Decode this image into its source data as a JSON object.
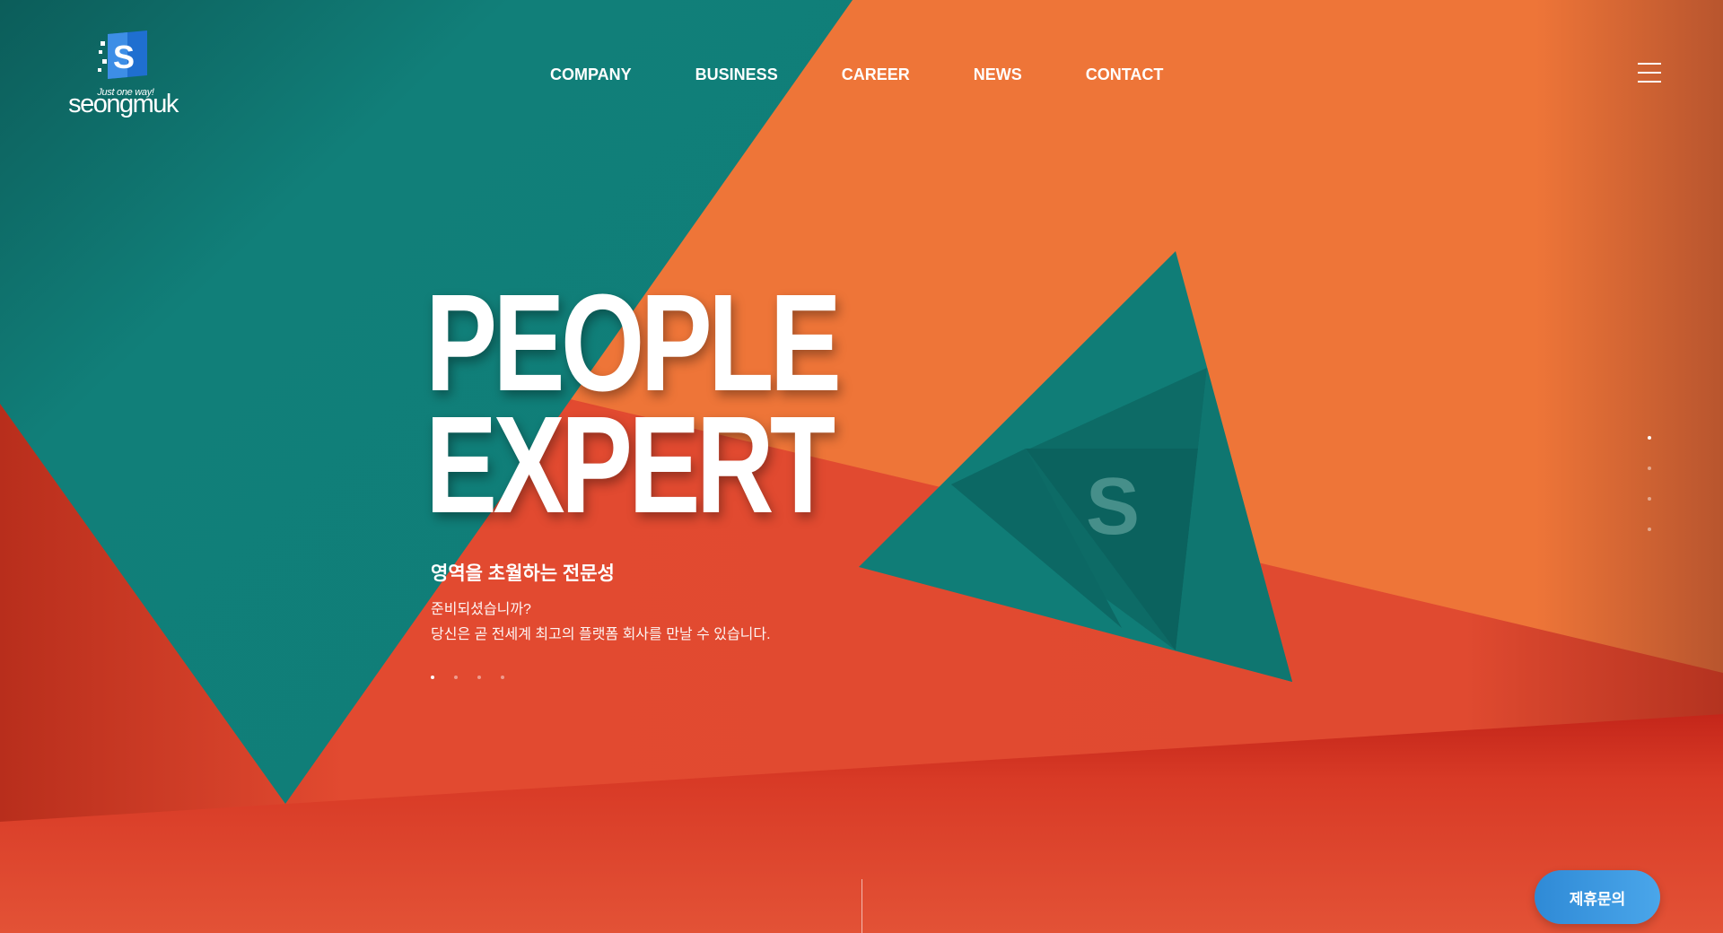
{
  "brand": {
    "logo_tagline": "Just one way!",
    "logo_wordmark": "seongmuk",
    "logo_letter": "S"
  },
  "nav": {
    "items": [
      {
        "label": "COMPANY"
      },
      {
        "label": "BUSINESS"
      },
      {
        "label": "CAREER"
      },
      {
        "label": "NEWS"
      },
      {
        "label": "CONTACT"
      }
    ]
  },
  "icons": {
    "menu": "hamburger-menu-icon",
    "logo": "logo-s-icon"
  },
  "hero": {
    "title_line1": "PEOPLE",
    "title_line2": "EXPERT",
    "subtitle": "영역을 초월하는 전문성",
    "desc_line1": "준비되셨습니까?",
    "desc_line2": "당신은 곧 전세계 최고의 플랫폼 회사를 만날 수 있습니다.",
    "slide_count": 4,
    "active_slide": 1
  },
  "section_nav": {
    "count": 4,
    "active": 1
  },
  "cta": {
    "inquiry_label": "제휴문의"
  },
  "colors": {
    "teal": "#10807a",
    "orange": "#ee7538",
    "red": "#e24a30",
    "button_blue": "#3b97e0"
  }
}
